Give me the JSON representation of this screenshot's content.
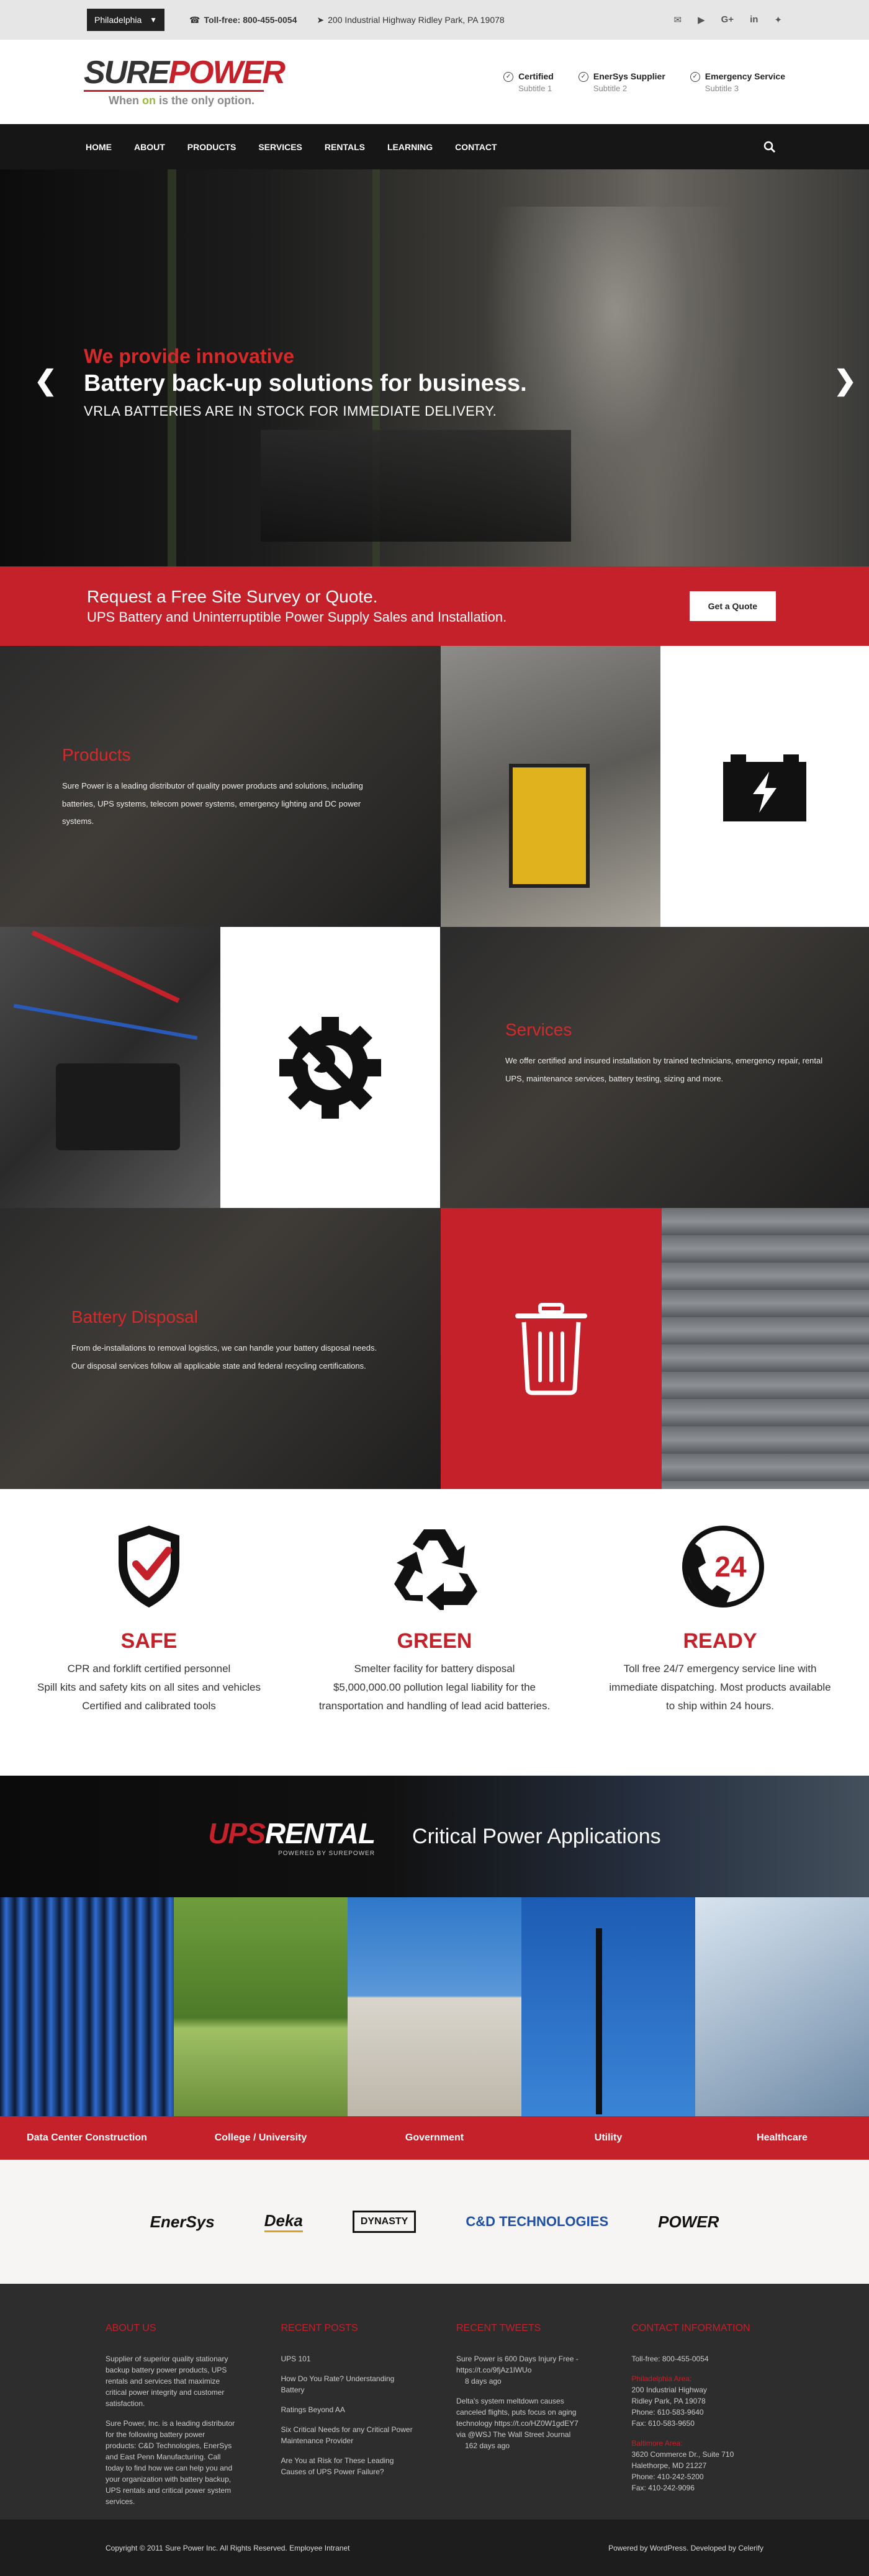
{
  "topbar": {
    "city": "Philadelphia",
    "tollfree": "Toll-free: 800-455-0054",
    "address": "200 Industrial Highway   Ridley Park, PA 19078",
    "social": [
      "email-icon",
      "youtube-icon",
      "google-plus-icon",
      "linkedin-icon",
      "twitter-icon"
    ]
  },
  "header": {
    "logo_sure": "SURE",
    "logo_power": "POWER",
    "logo_tag_pre": "When ",
    "logo_tag_on": "on",
    "logo_tag_post": " is the only option.",
    "features": [
      {
        "title": "Certified",
        "subtitle": "Subtitle 1"
      },
      {
        "title": "EnerSys Supplier",
        "subtitle": "Subtitle 2"
      },
      {
        "title": "Emergency Service",
        "subtitle": "Subtitle 3"
      }
    ]
  },
  "nav": {
    "items": [
      "HOME",
      "ABOUT",
      "PRODUCTS",
      "SERVICES",
      "RENTALS",
      "LEARNING",
      "CONTACT"
    ],
    "active": "HOME"
  },
  "hero": {
    "line1": "We provide innovative",
    "line2": "Battery back-up solutions for business.",
    "line3": "VRLA BATTERIES ARE IN STOCK FOR IMMEDIATE DELIVERY."
  },
  "cta": {
    "title": "Request a Free Site Survey or Quote.",
    "subtitle": "UPS Battery and Uninterruptible Power Supply Sales and Installation.",
    "button": "Get a Quote"
  },
  "products": {
    "heading": "Products",
    "text": "Sure Power is a leading distributor of quality power products and solutions, including batteries, UPS systems, telecom power systems, emergency lighting and DC power systems."
  },
  "services": {
    "heading": "Services",
    "text": "We offer certified and insured installation by trained technicians, emergency repair, rental UPS, maintenance services, battery testing, sizing and more."
  },
  "disposal": {
    "heading": "Battery Disposal",
    "text1": "From de-installations to removal logistics, we can handle your battery disposal needs.",
    "text2": "Our disposal services follow all applicable state and federal recycling certifications."
  },
  "values": [
    {
      "icon": "shield-check-icon",
      "heading": "SAFE",
      "lines": [
        "CPR and forklift certified personnel",
        "Spill kits and safety kits on all sites and vehicles",
        "Certified and calibrated tools"
      ]
    },
    {
      "icon": "recycle-icon",
      "heading": "GREEN",
      "lines": [
        "Smelter facility for battery disposal",
        "$5,000,000.00 pollution legal liability for the",
        "transportation and handling of lead acid batteries."
      ]
    },
    {
      "icon": "phone-24-icon",
      "heading": "READY",
      "lines": [
        "Toll free 24/7 emergency service line with",
        "immediate dispatching. Most products available",
        "to ship within 24 hours."
      ]
    }
  ],
  "rental": {
    "logo_ups": "UPS",
    "logo_rental": "RENTAL",
    "logo_sub": "POWERED BY SUREPOWER",
    "tagline": "Critical Power Applications"
  },
  "applications": [
    "Data Center Construction",
    "College / University",
    "Government",
    "Utility",
    "Healthcare"
  ],
  "brands": [
    "EnerSys",
    "Deka",
    "DYNASTY",
    "C&D TECHNOLOGIES",
    "POWER"
  ],
  "footer": {
    "about_heading": "ABOUT US",
    "about_p1": "Supplier of superior quality stationary backup battery power products, UPS rentals and services that maximize critical power integrity and customer satisfaction.",
    "about_p2": "Sure Power, Inc. is a leading distributor for the following battery power products: C&D Technologies, EnerSys and East Penn Manufacturing. Call today to find how we can help you and your organization with battery backup, UPS rentals and critical power system services.",
    "posts_heading": "RECENT POSTS",
    "posts": [
      "UPS 101",
      "How Do You Rate? Understanding Battery",
      "Ratings Beyond AA",
      "Six Critical Needs for any Critical Power Maintenance Provider",
      "Are You at Risk for These Leading Causes of UPS Power Failure?"
    ],
    "tweets_heading": "RECENT TWEETS",
    "tweet1": "Sure Power is 600 Days Injury Free - https://t.co/9fjAz1lWUo",
    "tweet1_age": "8 days ago",
    "tweet2": "Delta's system meltdown causes canceled flights, puts focus on aging technology https://t.co/HZ0W1gdEY7 via @WSJ The Wall Street Journal",
    "tweet2_age": "162 days ago",
    "contact_heading": "CONTACT INFORMATION",
    "tollfree": "Toll-free: 800-455-0054",
    "philly_label": "Philadelphia Area:",
    "philly_lines": [
      "200 Industrial Highway",
      "Ridley Park, PA 19078",
      "Phone: 610-583-9640",
      "Fax: 610-583-9650"
    ],
    "balt_label": "Baltimore Area:",
    "balt_lines": [
      "3620 Commerce Dr., Suite 710",
      "Halethorpe, MD 21227",
      "Phone: 410-242-5200",
      "Fax: 410-242-9096"
    ]
  },
  "bottom": {
    "copyright": "Copyright © 2011 Sure Power Inc. All Rights Reserved. Employee Intranet",
    "credit": "Powered by WordPress. Developed by Celerify"
  },
  "colors": {
    "brand_red": "#c4212b",
    "dark": "#161616",
    "footer": "#2d2d2d"
  }
}
